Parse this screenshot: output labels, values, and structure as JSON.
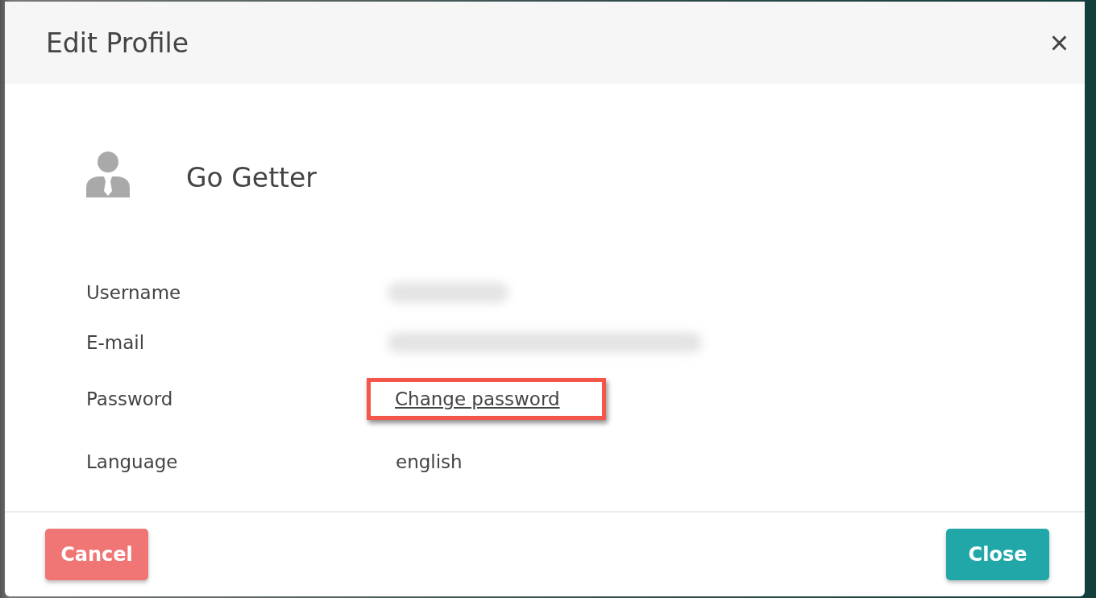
{
  "dialog": {
    "title": "Edit Profile",
    "close_icon": "×"
  },
  "profile": {
    "name": "Go Getter"
  },
  "fields": [
    {
      "label": "Username",
      "kind": "blurred"
    },
    {
      "label": "E-mail",
      "kind": "blurred"
    },
    {
      "label": "Password",
      "kind": "link",
      "value": "Change password",
      "highlighted": true
    },
    {
      "label": "Language",
      "kind": "text",
      "value": "english",
      "highlighted": false
    }
  ],
  "buttons": [
    {
      "label": "Cancel",
      "kind": "danger"
    },
    {
      "label": "Close",
      "kind": "primary"
    }
  ]
}
